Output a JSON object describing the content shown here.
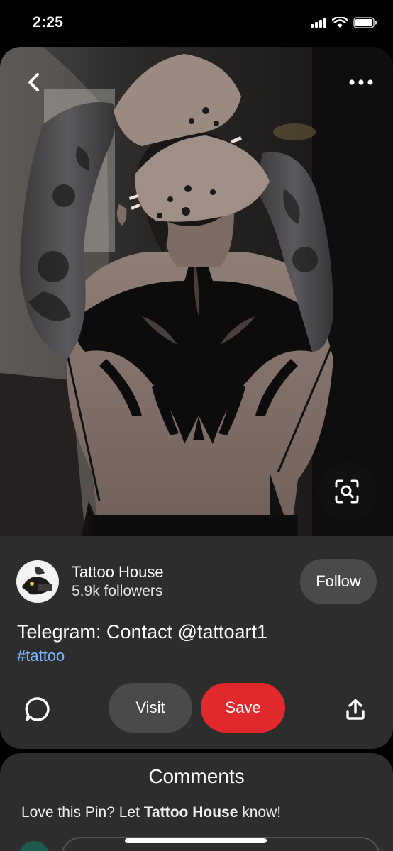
{
  "status_bar": {
    "time": "2:25"
  },
  "pin": {
    "image_alt": "Back view of a person with a large black ornamental back tattoo and tattooed sleeves and hands",
    "creator": {
      "name": "Tattoo House",
      "followers": "5.9k followers"
    },
    "follow_label": "Follow",
    "title": "Telegram: Contact @tattoart1",
    "hashtag": "#tattoo"
  },
  "actions": {
    "visit_label": "Visit",
    "save_label": "Save"
  },
  "comments": {
    "title": "Comments",
    "prompt_prefix": "Love this Pin? Let ",
    "prompt_name": "Tattoo House",
    "prompt_suffix": " know!"
  },
  "colors": {
    "background": "#000000",
    "card": "#2d2d2d",
    "secondary_button": "#4a4a4a",
    "save_button": "#e0282d",
    "hashtag": "#7eb6ff"
  },
  "icons": [
    "back-arrow-icon",
    "more-dots-icon",
    "visual-search-icon",
    "comment-bubble-icon",
    "share-icon",
    "signal-icon",
    "wifi-icon",
    "battery-icon"
  ]
}
